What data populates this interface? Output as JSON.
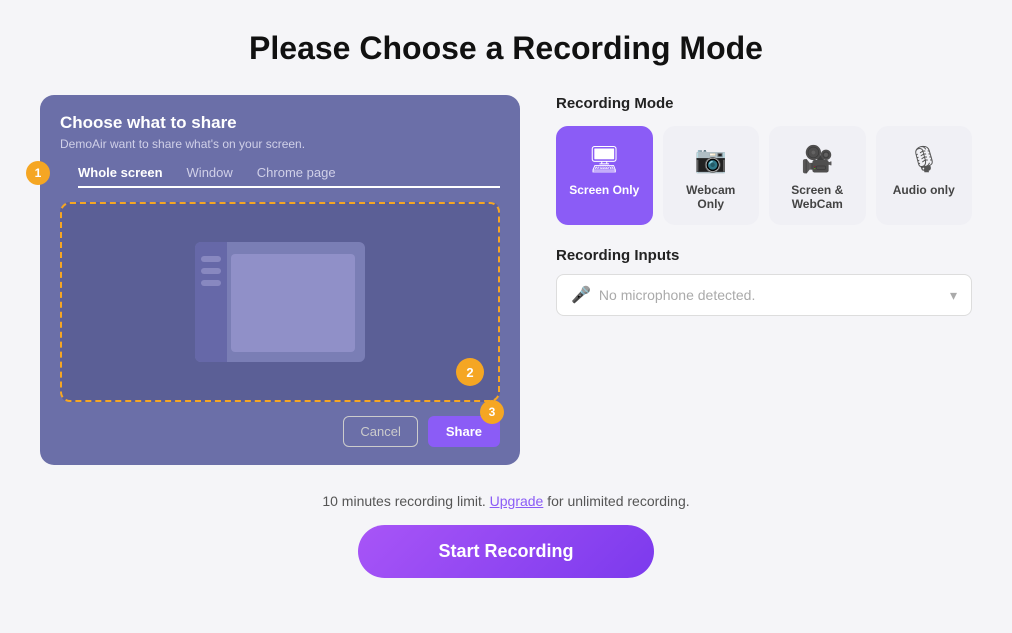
{
  "page": {
    "title": "Please Choose a Recording Mode"
  },
  "left_panel": {
    "title": "Choose what to share",
    "subtitle": "DemoAir want to share what's on your screen.",
    "tabs": [
      {
        "label": "Whole screen",
        "active": true
      },
      {
        "label": "Window",
        "active": false
      },
      {
        "label": "Chrome page",
        "active": false
      }
    ],
    "step1": "1",
    "step2": "2",
    "step3": "3",
    "cancel_label": "Cancel",
    "share_label": "Share"
  },
  "recording_modes": {
    "section_label": "Recording Mode",
    "modes": [
      {
        "id": "screen-only",
        "label": "Screen Only",
        "icon": "🖥",
        "active": true
      },
      {
        "id": "webcam-only",
        "label": "Webcam Only",
        "icon": "📷",
        "active": false
      },
      {
        "id": "screen-webcam",
        "label": "Screen & WebCam",
        "icon": "🎥",
        "active": false
      },
      {
        "id": "audio-only",
        "label": "Audio only",
        "icon": "🎙",
        "active": false
      }
    ]
  },
  "recording_inputs": {
    "section_label": "Recording Inputs",
    "mic_placeholder": "No microphone detected."
  },
  "bottom": {
    "limit_text_before": "10 minutes recording limit.",
    "upgrade_label": "Upgrade",
    "limit_text_after": "for unlimited recording.",
    "start_button": "Start Recording"
  }
}
